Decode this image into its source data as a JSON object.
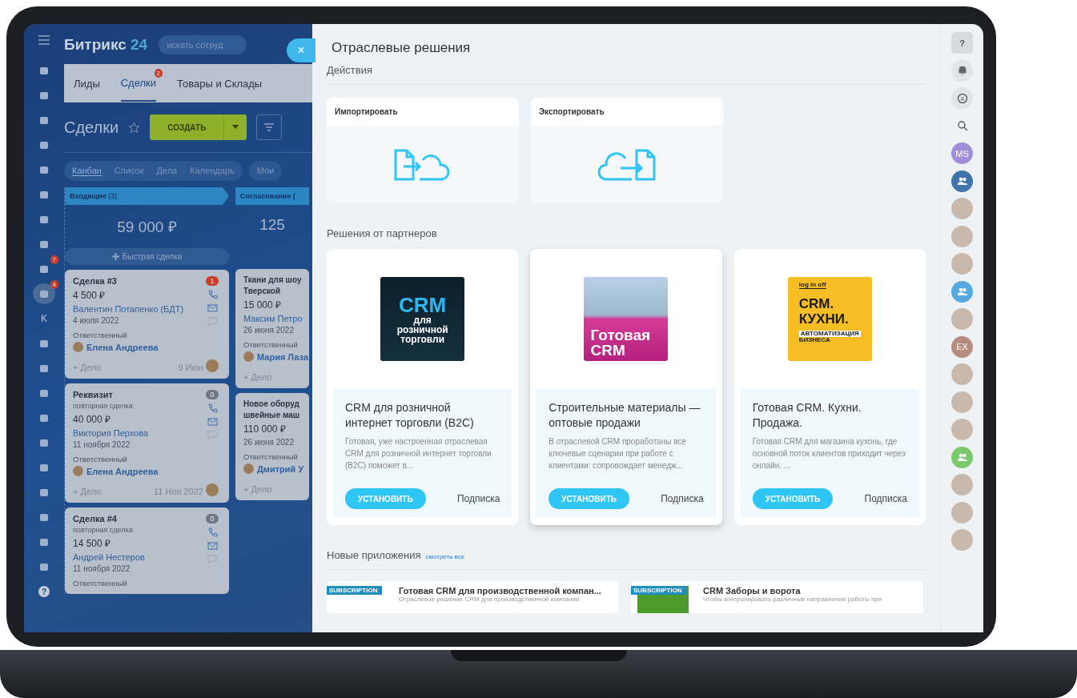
{
  "crm": {
    "logo_text": "Битрикс",
    "logo_number": "24",
    "search": {
      "placeholder": "искать сотруд"
    },
    "nav": [
      {
        "kind": "icon",
        "selected": false
      },
      {
        "kind": "icon",
        "selected": false
      },
      {
        "kind": "icon",
        "selected": false
      },
      {
        "kind": "icon",
        "selected": false
      },
      {
        "kind": "icon",
        "selected": false
      },
      {
        "kind": "icon",
        "selected": false
      },
      {
        "kind": "icon",
        "selected": false
      },
      {
        "kind": "icon",
        "selected": false
      },
      {
        "kind": "icon",
        "selected": false,
        "badge": "7"
      },
      {
        "kind": "icon",
        "selected": true,
        "badge": "4"
      },
      {
        "kind": "letter",
        "label": "K",
        "selected": false
      },
      {
        "kind": "icon",
        "selected": false
      },
      {
        "kind": "icon",
        "selected": false
      },
      {
        "kind": "icon",
        "selected": false
      },
      {
        "kind": "icon",
        "selected": false
      },
      {
        "kind": "icon",
        "selected": false
      },
      {
        "kind": "icon",
        "selected": false
      },
      {
        "kind": "icon",
        "selected": false
      },
      {
        "kind": "icon",
        "selected": false
      },
      {
        "kind": "icon",
        "selected": false
      },
      {
        "kind": "icon",
        "selected": false
      },
      {
        "kind": "help",
        "label": "?",
        "selected": false
      }
    ],
    "tabs": [
      {
        "label": "Лиды",
        "selected": false
      },
      {
        "label": "Сделки",
        "selected": true,
        "badge": "2"
      },
      {
        "label": "Товары и Склады",
        "selected": false
      }
    ],
    "title": "Сделки",
    "create_button": "СОЗДАТЬ",
    "views": [
      {
        "label": "Канбан",
        "selected": true
      },
      {
        "label": "Список",
        "selected": false
      },
      {
        "label": "Дела",
        "selected": false
      },
      {
        "label": "Календарь",
        "selected": false
      }
    ],
    "views_more": "Мои",
    "columns": [
      {
        "name": "Входящие",
        "count": "(3)",
        "sum": "59 000 ₽",
        "quick_add": "Быстрая сделка",
        "cards": [
          {
            "title": "Сделка #3",
            "amount": "4 500 ₽",
            "client": "Валентин Потапенко (БДТ)",
            "date": "4 июля 2022",
            "responsible_label": "Ответственный",
            "responsible": "Елена Андреева",
            "task": "+ Дело",
            "due": "9 Июн",
            "counter": "1",
            "alert": true
          },
          {
            "title": "Реквизит",
            "subtitle": "повторная сделка",
            "amount": "40 000 ₽",
            "client": "Виктория Перхова",
            "date": "11 ноября 2022",
            "responsible_label": "Ответственный",
            "responsible": "Елена Андреева",
            "task": "+ Дело",
            "due": "11 Ноя 2022",
            "counter": "0",
            "alert": false
          },
          {
            "title": "Сделка #4",
            "subtitle": "повторная сделка",
            "amount": "14 500 ₽",
            "client": "Андрей Нестеров",
            "date": "11 ноября 2022",
            "responsible_label": "Ответственный",
            "counter": "0",
            "alert": false
          }
        ]
      },
      {
        "name": "Согласование (",
        "sum": "125",
        "cards": [
          {
            "title": "Ткани для шоу",
            "title_line2": "Тверской",
            "amount": "15 000 ₽",
            "client": "Максим Петро",
            "date": "26 июня 2022",
            "responsible_label": "Ответственный",
            "responsible": "Мария Лаза",
            "task": "+ Дело"
          },
          {
            "title": "Новое оборуд",
            "title_line2": "швейные маш",
            "amount": "110 000 ₽",
            "date": "26 июня 2022",
            "responsible_label": "Ответственный",
            "responsible": "Дмитрий У",
            "task": "+ Дело"
          }
        ]
      }
    ]
  },
  "panel": {
    "close": "×",
    "title": "Отраслевые решения",
    "actions_title": "Действия",
    "actions": [
      {
        "kind": "import",
        "label": "Импортировать"
      },
      {
        "kind": "export",
        "label": "Экспортировать"
      }
    ],
    "partners_title": "Решения от партнеров",
    "partners": [
      {
        "kind": "retail",
        "banner": [
          "CRM",
          "для",
          "розничной",
          "торговли"
        ],
        "title": "CRM для розничной интернет торговли (B2C)",
        "description": "Готовая, уже настроенная отраслевая CRM для розничной интернет торговли (B2C) поможет в...",
        "button": "УСТАНОВИТЬ",
        "price": "Подписка",
        "hovered": false
      },
      {
        "kind": "construction",
        "banner": [
          "Готовая",
          "CRM"
        ],
        "title": "Строительные материалы — оптовые продажи",
        "description": "В отраслевой CRM проработаны все ключевые сценарии при работе с клиентами: сопровождает менедж...",
        "button": "УСТАНОВИТЬ",
        "price": "Подписка",
        "hovered": true
      },
      {
        "kind": "kitchen",
        "banner": [
          "log in off",
          "CRM.",
          "КУХНИ.",
          "АВТОМАТИЗАЦИЯ",
          "БИЗНЕСА"
        ],
        "title": "Готовая CRM. Кухни. Продажа.",
        "description": "Готовая CRM для магазина кухонь, где основной поток клиентов приходит через онлайн. ...",
        "button": "УСТАНОВИТЬ",
        "price": "Подписка",
        "hovered": false
      }
    ],
    "apps_title": "Новые приложения",
    "apps_link": "смотреть все",
    "apps": [
      {
        "kind": "factory",
        "badge": "SUBSCRIPTION",
        "title": "Готовая CRM для производственной компан...",
        "description": "Отраслевое решение CRM для производственной компании"
      },
      {
        "kind": "fence",
        "badge": "SUBSCRIPTION",
        "title": "CRM Заборы и ворота",
        "description": "Чтобы контролировать различные направления работы при"
      }
    ]
  },
  "rail": [
    {
      "kind": "help",
      "label": "?",
      "selected": true
    },
    {
      "kind": "bell"
    },
    {
      "kind": "chat"
    },
    {
      "kind": "search"
    },
    {
      "kind": "initials",
      "label": "MS",
      "color": "#a08fd8"
    },
    {
      "kind": "group",
      "color": "#3f74ad"
    },
    {
      "kind": "photo"
    },
    {
      "kind": "photo"
    },
    {
      "kind": "photo"
    },
    {
      "kind": "group",
      "color": "#55a8e0"
    },
    {
      "kind": "photo"
    },
    {
      "kind": "initials",
      "label": "EX",
      "color": "#b58d7f"
    },
    {
      "kind": "photo"
    },
    {
      "kind": "photo"
    },
    {
      "kind": "photo"
    },
    {
      "kind": "group",
      "color": "#79c96b"
    },
    {
      "kind": "photo"
    },
    {
      "kind": "photo"
    },
    {
      "kind": "photo"
    }
  ]
}
